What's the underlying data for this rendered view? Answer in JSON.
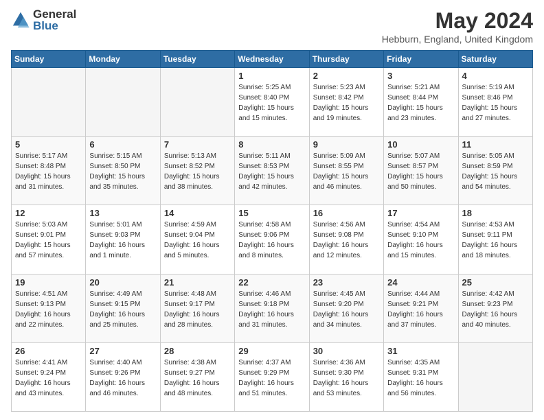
{
  "logo": {
    "general": "General",
    "blue": "Blue"
  },
  "title": "May 2024",
  "subtitle": "Hebburn, England, United Kingdom",
  "headers": [
    "Sunday",
    "Monday",
    "Tuesday",
    "Wednesday",
    "Thursday",
    "Friday",
    "Saturday"
  ],
  "weeks": [
    [
      {
        "day": "",
        "info": ""
      },
      {
        "day": "",
        "info": ""
      },
      {
        "day": "",
        "info": ""
      },
      {
        "day": "1",
        "info": "Sunrise: 5:25 AM\nSunset: 8:40 PM\nDaylight: 15 hours\nand 15 minutes."
      },
      {
        "day": "2",
        "info": "Sunrise: 5:23 AM\nSunset: 8:42 PM\nDaylight: 15 hours\nand 19 minutes."
      },
      {
        "day": "3",
        "info": "Sunrise: 5:21 AM\nSunset: 8:44 PM\nDaylight: 15 hours\nand 23 minutes."
      },
      {
        "day": "4",
        "info": "Sunrise: 5:19 AM\nSunset: 8:46 PM\nDaylight: 15 hours\nand 27 minutes."
      }
    ],
    [
      {
        "day": "5",
        "info": "Sunrise: 5:17 AM\nSunset: 8:48 PM\nDaylight: 15 hours\nand 31 minutes."
      },
      {
        "day": "6",
        "info": "Sunrise: 5:15 AM\nSunset: 8:50 PM\nDaylight: 15 hours\nand 35 minutes."
      },
      {
        "day": "7",
        "info": "Sunrise: 5:13 AM\nSunset: 8:52 PM\nDaylight: 15 hours\nand 38 minutes."
      },
      {
        "day": "8",
        "info": "Sunrise: 5:11 AM\nSunset: 8:53 PM\nDaylight: 15 hours\nand 42 minutes."
      },
      {
        "day": "9",
        "info": "Sunrise: 5:09 AM\nSunset: 8:55 PM\nDaylight: 15 hours\nand 46 minutes."
      },
      {
        "day": "10",
        "info": "Sunrise: 5:07 AM\nSunset: 8:57 PM\nDaylight: 15 hours\nand 50 minutes."
      },
      {
        "day": "11",
        "info": "Sunrise: 5:05 AM\nSunset: 8:59 PM\nDaylight: 15 hours\nand 54 minutes."
      }
    ],
    [
      {
        "day": "12",
        "info": "Sunrise: 5:03 AM\nSunset: 9:01 PM\nDaylight: 15 hours\nand 57 minutes."
      },
      {
        "day": "13",
        "info": "Sunrise: 5:01 AM\nSunset: 9:03 PM\nDaylight: 16 hours\nand 1 minute."
      },
      {
        "day": "14",
        "info": "Sunrise: 4:59 AM\nSunset: 9:04 PM\nDaylight: 16 hours\nand 5 minutes."
      },
      {
        "day": "15",
        "info": "Sunrise: 4:58 AM\nSunset: 9:06 PM\nDaylight: 16 hours\nand 8 minutes."
      },
      {
        "day": "16",
        "info": "Sunrise: 4:56 AM\nSunset: 9:08 PM\nDaylight: 16 hours\nand 12 minutes."
      },
      {
        "day": "17",
        "info": "Sunrise: 4:54 AM\nSunset: 9:10 PM\nDaylight: 16 hours\nand 15 minutes."
      },
      {
        "day": "18",
        "info": "Sunrise: 4:53 AM\nSunset: 9:11 PM\nDaylight: 16 hours\nand 18 minutes."
      }
    ],
    [
      {
        "day": "19",
        "info": "Sunrise: 4:51 AM\nSunset: 9:13 PM\nDaylight: 16 hours\nand 22 minutes."
      },
      {
        "day": "20",
        "info": "Sunrise: 4:49 AM\nSunset: 9:15 PM\nDaylight: 16 hours\nand 25 minutes."
      },
      {
        "day": "21",
        "info": "Sunrise: 4:48 AM\nSunset: 9:17 PM\nDaylight: 16 hours\nand 28 minutes."
      },
      {
        "day": "22",
        "info": "Sunrise: 4:46 AM\nSunset: 9:18 PM\nDaylight: 16 hours\nand 31 minutes."
      },
      {
        "day": "23",
        "info": "Sunrise: 4:45 AM\nSunset: 9:20 PM\nDaylight: 16 hours\nand 34 minutes."
      },
      {
        "day": "24",
        "info": "Sunrise: 4:44 AM\nSunset: 9:21 PM\nDaylight: 16 hours\nand 37 minutes."
      },
      {
        "day": "25",
        "info": "Sunrise: 4:42 AM\nSunset: 9:23 PM\nDaylight: 16 hours\nand 40 minutes."
      }
    ],
    [
      {
        "day": "26",
        "info": "Sunrise: 4:41 AM\nSunset: 9:24 PM\nDaylight: 16 hours\nand 43 minutes."
      },
      {
        "day": "27",
        "info": "Sunrise: 4:40 AM\nSunset: 9:26 PM\nDaylight: 16 hours\nand 46 minutes."
      },
      {
        "day": "28",
        "info": "Sunrise: 4:38 AM\nSunset: 9:27 PM\nDaylight: 16 hours\nand 48 minutes."
      },
      {
        "day": "29",
        "info": "Sunrise: 4:37 AM\nSunset: 9:29 PM\nDaylight: 16 hours\nand 51 minutes."
      },
      {
        "day": "30",
        "info": "Sunrise: 4:36 AM\nSunset: 9:30 PM\nDaylight: 16 hours\nand 53 minutes."
      },
      {
        "day": "31",
        "info": "Sunrise: 4:35 AM\nSunset: 9:31 PM\nDaylight: 16 hours\nand 56 minutes."
      },
      {
        "day": "",
        "info": ""
      }
    ]
  ]
}
